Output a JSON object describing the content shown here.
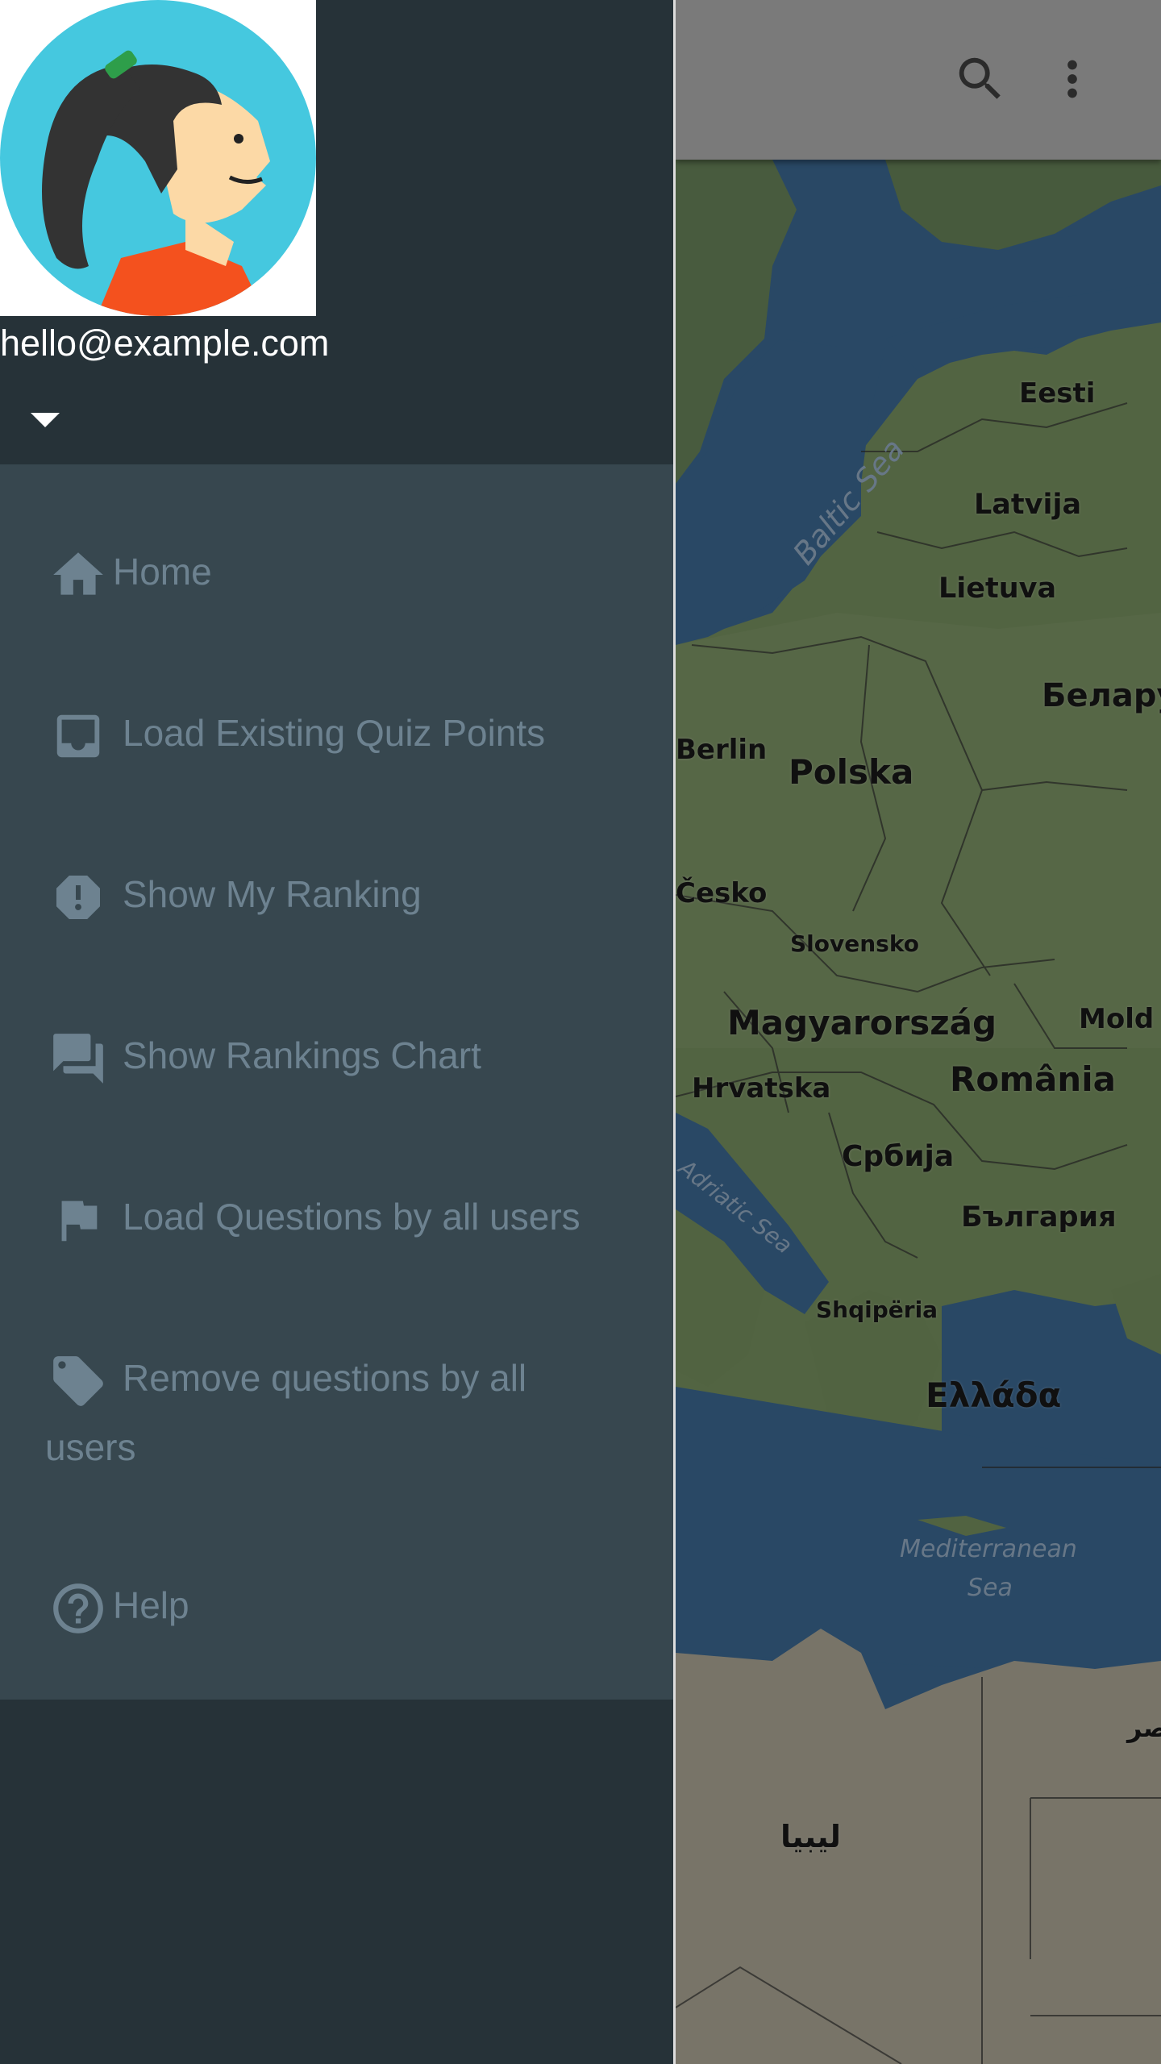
{
  "app_bar": {
    "icons": [
      "search-icon",
      "more-vert-icon"
    ]
  },
  "drawer": {
    "header": {
      "email": "hello@example.com",
      "avatar": "woman-avatar",
      "dropdown_icon": "arrow-drop-down-icon"
    },
    "items": [
      {
        "label": "Home",
        "icon": "home-icon"
      },
      {
        "label": "Load Existing Quiz Points",
        "icon": "inbox-icon"
      },
      {
        "label": "Show My Ranking",
        "icon": "report-icon"
      },
      {
        "label": "Show Rankings Chart",
        "icon": "forum-icon"
      },
      {
        "label": "Load Questions by all users",
        "icon": "flag-icon"
      },
      {
        "label_line1": "Remove questions by all",
        "label_line2": "users",
        "icon": "label-icon"
      },
      {
        "label": "Help",
        "icon": "help-icon"
      }
    ]
  },
  "map": {
    "labels": {
      "eesti": "Eesti",
      "latvija": "Latvija",
      "lietuva": "Lietuva",
      "belarus": "Белару",
      "berlin": "Berlin",
      "polska": "Polska",
      "cesko": "Česko",
      "slovensko": "Slovensko",
      "magyarorszag": "Magyarország",
      "moldova": "Mold",
      "hrvatska": "Hrvatska",
      "romania": "România",
      "srbija": "Србија",
      "bulgaria": "България",
      "shqiperia": "Shqipëria",
      "ellada": "Ελλάδα",
      "libya": "ليبيا",
      "egypt": "مصر",
      "baltic_sea": "Baltic Sea",
      "adriatic_sea": "Adriatic Sea",
      "mediterranean_line1": "Mediterranean",
      "mediterranean_line2": "Sea"
    }
  },
  "colors": {
    "drawer_bg": "#263238",
    "menu_bg": "#37474f",
    "menu_text": "#6d8290",
    "app_bar": "#7a7a7a"
  }
}
